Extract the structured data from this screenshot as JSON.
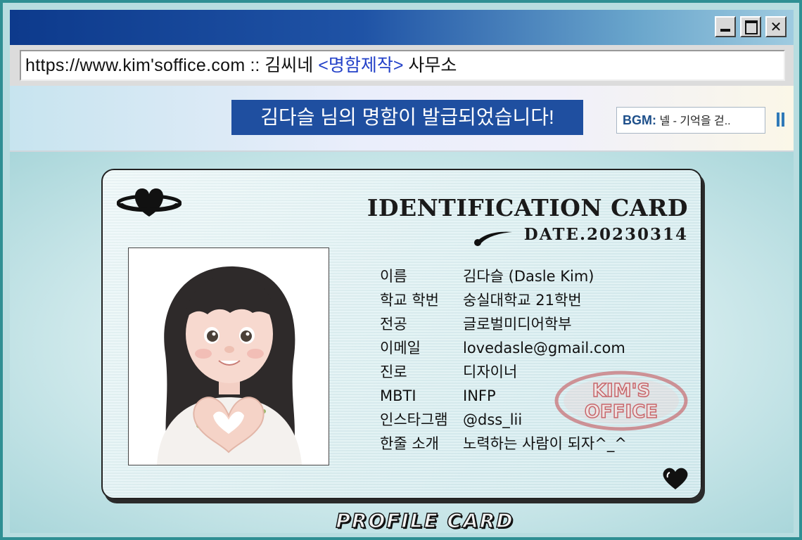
{
  "window": {
    "controls": [
      "minimize",
      "maximize",
      "close"
    ],
    "close_glyph": "✕"
  },
  "address_bar": {
    "url": "https://www.kim'soffice.com",
    "separator": " :: ",
    "site_name_part1": "김씨네 ",
    "site_name_highlight": "<명함제작>",
    "site_name_part2": " 사무소"
  },
  "banner": {
    "notice": "김다슬 님의 명함이 발급되었습니다!",
    "bgm_label": "BGM:",
    "bgm_song": " 넬 - 기억을 걷..",
    "icons": {
      "pause": "pause-icon"
    }
  },
  "card": {
    "title": "IDENTIFICATION CARD",
    "date": "DATE.20230314",
    "rows": [
      {
        "key": "이름",
        "value": "김다슬 (Dasle Kim)"
      },
      {
        "key": "학교 학번",
        "value": "숭실대학교 21학번"
      },
      {
        "key": "전공",
        "value": "글로벌미디어학부"
      },
      {
        "key": "이메일",
        "value": "lovedasle@gmail.com"
      },
      {
        "key": "진로",
        "value": "디자이너"
      },
      {
        "key": "MBTI",
        "value": "INFP"
      },
      {
        "key": "인스타그램",
        "value": "@dss_lii"
      },
      {
        "key": "한줄 소개",
        "value": "노력하는 사람이 되자^_^"
      }
    ],
    "stamp_line1": "KIM'S",
    "stamp_line2": "OFFICE",
    "colors": {
      "stamp": "#c2474c",
      "notice_bg": "#1f4fa0"
    }
  },
  "footer": {
    "label": "PROFILE CARD"
  }
}
